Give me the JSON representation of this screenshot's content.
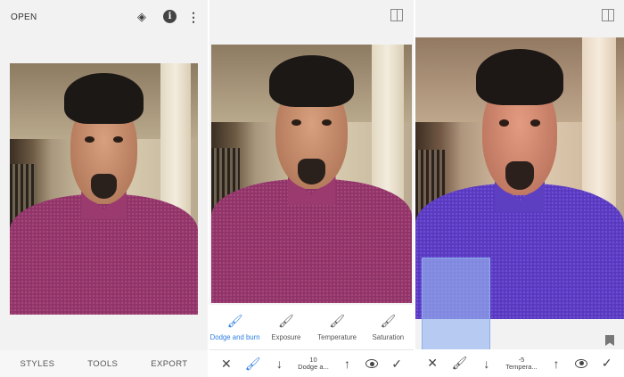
{
  "panel1": {
    "open_label": "OPEN",
    "icons": [
      "layers-icon",
      "info-icon",
      "more-vert-icon"
    ],
    "info_glyph": "i",
    "nav": [
      "STYLES",
      "TOOLS",
      "EXPORT"
    ]
  },
  "panel2": {
    "tools": [
      {
        "label": "Dodge and burn",
        "icon": "brush-icon",
        "active": true
      },
      {
        "label": "Exposure",
        "icon": "brush-ev-icon",
        "active": false
      },
      {
        "label": "Temperature",
        "icon": "brush-temperature-icon",
        "active": false
      },
      {
        "label": "Saturation",
        "icon": "brush-saturation-icon",
        "active": false
      }
    ],
    "value": "10",
    "value_name": "Dodge a..."
  },
  "panel3": {
    "value": "-5",
    "value_name": "Tempera..."
  },
  "colors": {
    "accent": "#2f7de1",
    "background": "#f2f2f2",
    "selection": "#96b4f0"
  }
}
